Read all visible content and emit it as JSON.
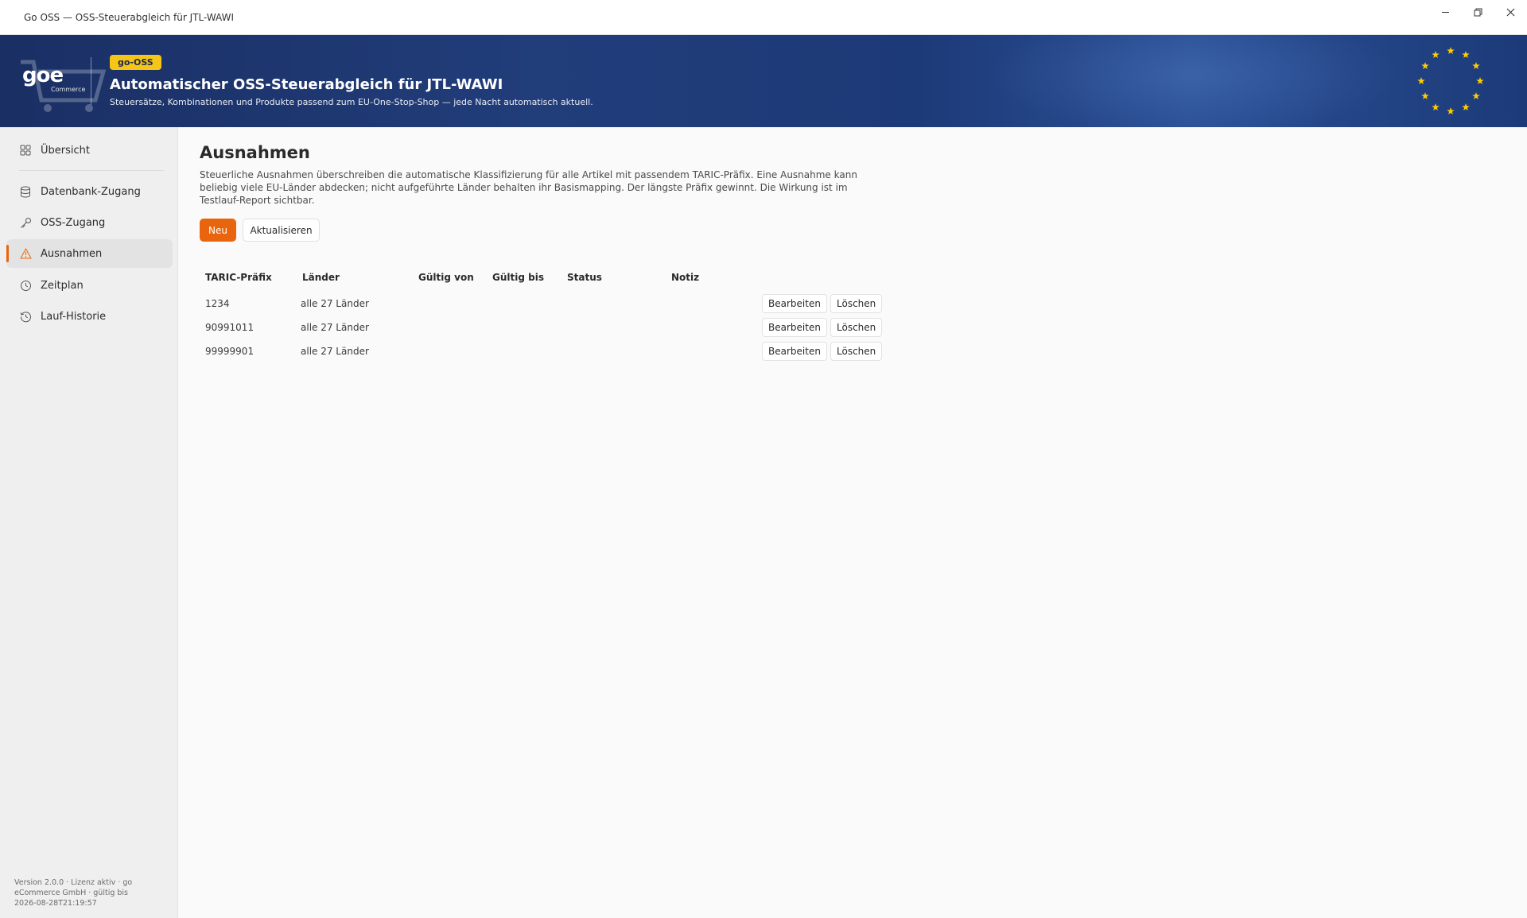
{
  "window": {
    "title": "Go OSS — OSS-Steuerabgleich für JTL-WAWI"
  },
  "banner": {
    "logo_text": "goe",
    "logo_sub": "Commerce",
    "badge": "go-OSS",
    "title": "Automatischer OSS-Steuerabgleich für JTL-WAWI",
    "subtitle": "Steuersätze, Kombinationen und Produkte passend zum EU-One-Stop-Shop — jede Nacht automatisch aktuell."
  },
  "sidebar": {
    "items": [
      {
        "label": "Übersicht",
        "icon": "grid-icon"
      },
      {
        "label": "Datenbank-Zugang",
        "icon": "database-icon"
      },
      {
        "label": "OSS-Zugang",
        "icon": "key-icon"
      },
      {
        "label": "Ausnahmen",
        "icon": "warning-icon"
      },
      {
        "label": "Zeitplan",
        "icon": "clock-icon"
      },
      {
        "label": "Lauf-Historie",
        "icon": "history-icon"
      }
    ],
    "active": "Ausnahmen",
    "footer": "Version 2.0.0 · Lizenz aktiv · go eCommerce GmbH · gültig bis 2026-08-28T21:19:57"
  },
  "main": {
    "title": "Ausnahmen",
    "description": "Steuerliche Ausnahmen überschreiben die automatische Klassifizierung für alle Artikel mit passendem TARIC-Präfix. Eine Ausnahme kann beliebig viele EU-Länder abdecken; nicht aufgeführte Länder behalten ihr Basismapping. Der längste Präfix gewinnt. Die Wirkung ist im Testlauf-Report sichtbar.",
    "new_button": "Neu",
    "refresh_button": "Aktualisieren"
  },
  "table": {
    "columns": [
      "TARIC-Präfix",
      "Länder",
      "Gültig von",
      "Gültig bis",
      "Status",
      "Notiz"
    ],
    "rows": [
      {
        "prefix": "1234",
        "countries": "alle 27 Länder",
        "valid_from": "",
        "valid_to": "",
        "status": "",
        "note": ""
      },
      {
        "prefix": "90991011",
        "countries": "alle 27 Länder",
        "valid_from": "",
        "valid_to": "",
        "status": "",
        "note": ""
      },
      {
        "prefix": "99999901",
        "countries": "alle 27 Länder",
        "valid_from": "",
        "valid_to": "",
        "status": "",
        "note": ""
      }
    ],
    "edit_label": "Bearbeiten",
    "delete_label": "Löschen"
  },
  "colors": {
    "accent": "#e8650e",
    "banner": "#1f3a78",
    "badge": "#f5c518",
    "eu_star": "#ffcc00"
  }
}
